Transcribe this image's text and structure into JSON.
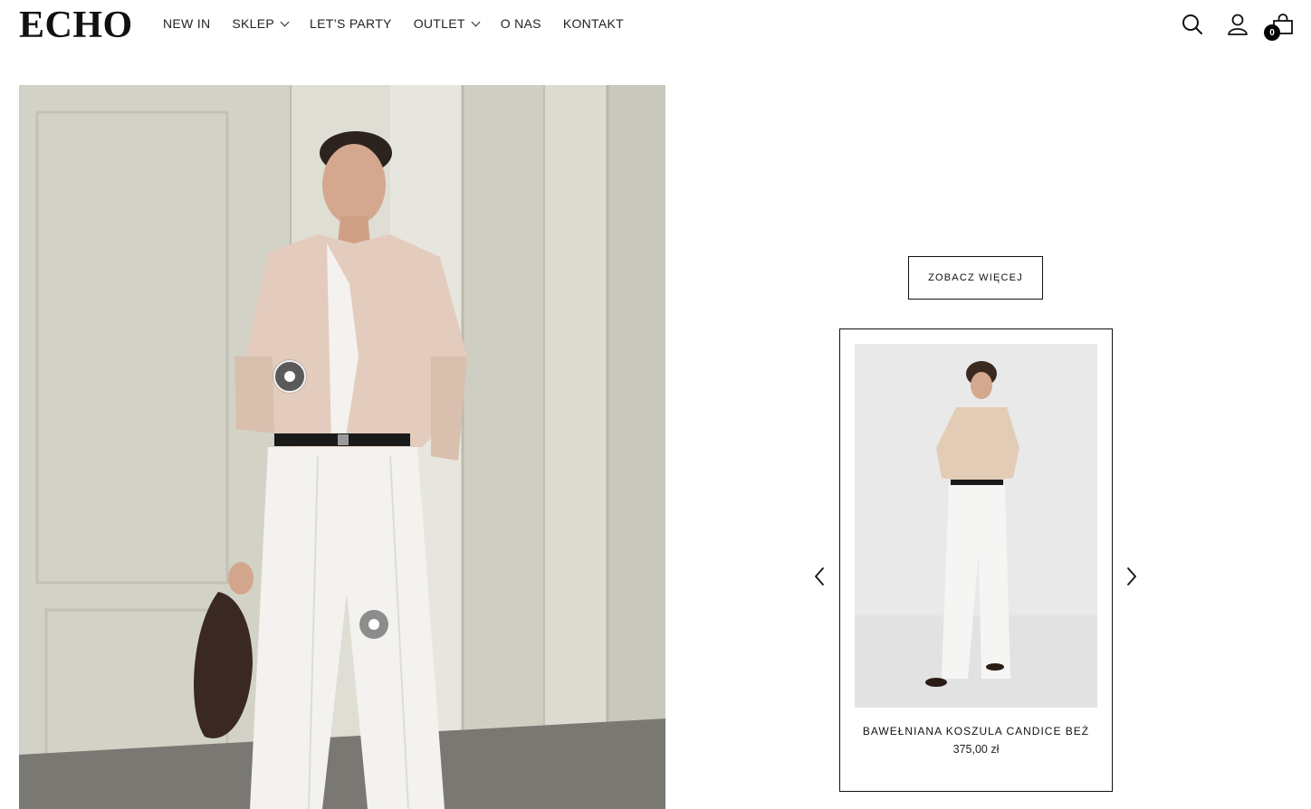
{
  "brand": {
    "logo_text": "ECHO"
  },
  "nav": {
    "items": [
      {
        "label": "NEW IN",
        "has_dropdown": false
      },
      {
        "label": "SKLEP",
        "has_dropdown": true
      },
      {
        "label": "LET’S PARTY",
        "has_dropdown": false
      },
      {
        "label": "OUTLET",
        "has_dropdown": true
      },
      {
        "label": "O NAS",
        "has_dropdown": false
      },
      {
        "label": "KONTAKT",
        "has_dropdown": false
      }
    ]
  },
  "header_icons": {
    "search": "search-icon",
    "account": "account-icon",
    "cart": "shopping-bag-icon",
    "cart_count": "0"
  },
  "hero": {
    "hotspots": [
      {
        "state": "active"
      },
      {
        "state": "inactive"
      }
    ]
  },
  "panel": {
    "see_more_label": "ZOBACZ WIĘCEJ",
    "product": {
      "title": "BAWEŁNIANA KOSZULA CANDICE BEŻ",
      "price": "375,00 zł"
    },
    "prev_icon": "chevron-left-icon",
    "next_icon": "chevron-right-icon"
  },
  "colors": {
    "text": "#111111",
    "background": "#ffffff",
    "badge": "#000000"
  }
}
